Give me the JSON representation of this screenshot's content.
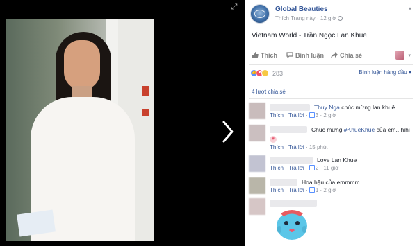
{
  "post": {
    "page_name": "Global Beauties",
    "meta_line": "Thích Trang này · 12 giờ",
    "caption": "Vietnam World - Trần Ngọc Lan Khue"
  },
  "actions": {
    "like": "Thích",
    "comment": "Bình luận",
    "share": "Chia sẻ"
  },
  "reactions": {
    "count": "283",
    "icons": [
      "like-icon",
      "love-icon",
      "haha-icon"
    ],
    "colors": {
      "like": "#5890ff",
      "love": "#f25268",
      "haha": "#f7c843"
    }
  },
  "sort_label": "Bình luận hàng đầu ▾",
  "shares_label": "4 lượt chia sẻ",
  "comments": [
    {
      "name": "Thuy Nga",
      "text": "chúc mừng lan khuê",
      "like": "Thích",
      "reply": "Trả lời",
      "likes": "3",
      "time": "2 giờ"
    },
    {
      "mention": "#KhuêKhuê",
      "text_before": "Chúc mừng ",
      "text_after": " của em...hihi",
      "like": "Thích",
      "reply": "Trả lời",
      "time": "15 phút"
    },
    {
      "text": "Love Lan Khue",
      "like": "Thích",
      "reply": "Trả lời",
      "likes": "2",
      "time": "11 giờ"
    },
    {
      "text": "Hoa hậu của emmmm",
      "like": "Thích",
      "reply": "Trả lời",
      "likes": "1",
      "time": "2 giờ"
    }
  ],
  "theme": {
    "link": "#365899",
    "muted": "#90949c",
    "viewer_bg": "#000000"
  }
}
